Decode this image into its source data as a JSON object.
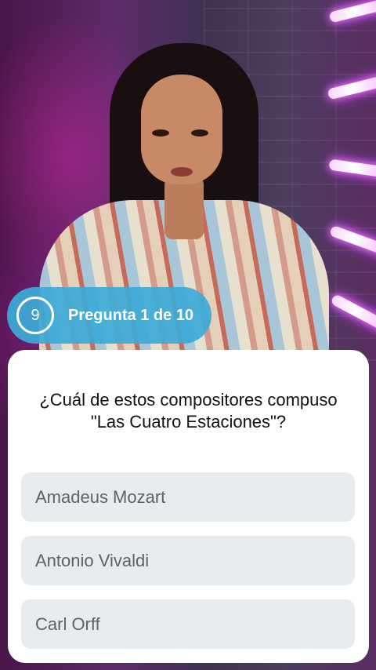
{
  "header": {
    "timer": "9",
    "progress_label": "Pregunta 1 de 10"
  },
  "quiz": {
    "question": "¿Cuál de estos compositores compuso \"Las Cuatro Estaciones\"?",
    "options": [
      "Amadeus Mozart",
      "Antonio Vivaldi",
      "Carl Orff"
    ]
  },
  "colors": {
    "badge": "#3caad7",
    "card": "#ffffff",
    "option_bg": "#e9ecef",
    "option_text": "#5a626a"
  }
}
